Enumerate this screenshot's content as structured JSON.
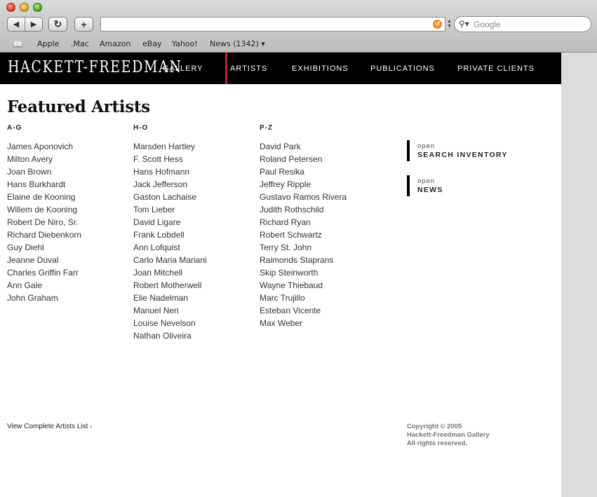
{
  "browser": {
    "back_icon": "◀",
    "forward_icon": "▶",
    "reload_icon": "↻",
    "add_icon": "+",
    "rss_icon": "↺",
    "search_placeholder": "Google",
    "bookmarks": [
      "Apple",
      ".Mac",
      "Amazon",
      "eBay",
      "Yahoo!",
      "News (1342) ▾"
    ]
  },
  "site": {
    "logo": "HACKETT-FREEDMAN",
    "nav": [
      "GALLERY",
      "ARTISTS",
      "EXHIBITIONS",
      "PUBLICATIONS",
      "PRIVATE CLIENTS"
    ],
    "active_nav": "ARTISTS",
    "accent_color": "#c8182a"
  },
  "main": {
    "title": "Featured Artists",
    "columns": [
      {
        "heading": "A-G",
        "artists": [
          "James Aponovich",
          "Milton Avery",
          "Joan Brown",
          "Hans Burkhardt",
          "Elaine de Kooning",
          "Willem de Kooning",
          "Robert De Niro, Sr.",
          "Richard Diebenkorn",
          "Guy Diehl",
          "Jeanne Duval",
          "Charles Griffin Farr",
          "Ann Gale",
          "John Graham"
        ]
      },
      {
        "heading": "H-O",
        "artists": [
          "Marsden Hartley",
          "F. Scott Hess",
          "Hans Hofmann",
          "Jack Jefferson",
          "Gaston Lachaise",
          "Tom Lieber",
          "David Ligare",
          "Frank Lobdell",
          "Ann Lofquist",
          "Carlo Maria Mariani",
          "Joan Mitchell",
          "Robert Motherwell",
          "Elie Nadelman",
          "Manuel Neri",
          "Louise Nevelson",
          "Nathan Oliveira"
        ]
      },
      {
        "heading": "P-Z",
        "artists": [
          "David Park",
          "Roland Petersen",
          "Paul Resika",
          "Jeffrey Ripple",
          "Gustavo Ramos Rivera",
          "Judith Rothschild",
          "Richard Ryan",
          "Robert Schwartz",
          "Terry St. John",
          "Raimonds Staprans",
          "Skip Steinworth",
          "Wayne Thiebaud",
          "Marc Trujillo",
          "Esteban Vicente",
          "Max Weber"
        ]
      }
    ],
    "side_links": [
      {
        "small": "open",
        "big": "SEARCH INVENTORY"
      },
      {
        "small": "open",
        "big": "NEWS"
      }
    ],
    "complete_list": "View Complete Artists List",
    "complete_list_arrow": "›",
    "copyright": [
      "Copyright © 2005",
      "Hackett-Freedman Gallery",
      "All rights reserved."
    ]
  }
}
